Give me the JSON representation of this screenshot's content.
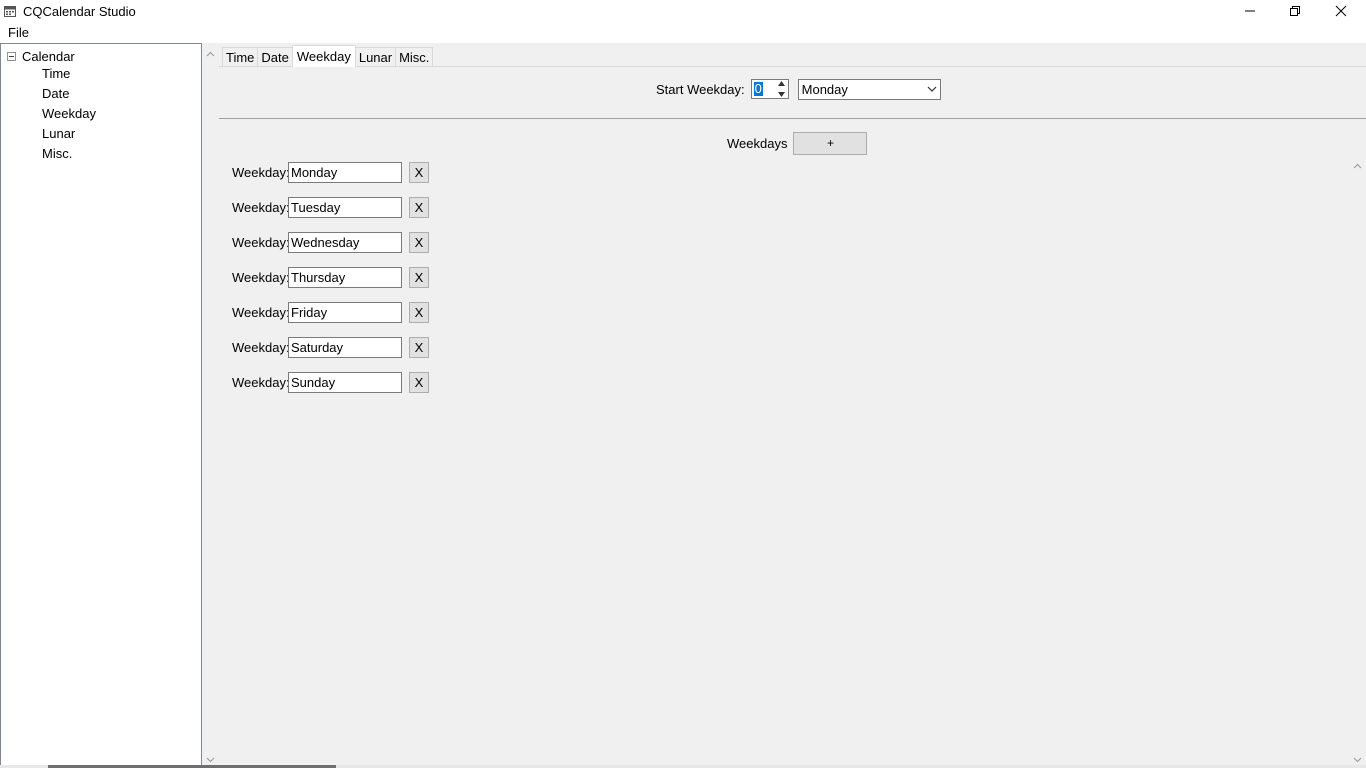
{
  "window": {
    "title": "CQCalendar Studio",
    "minimize_glyph": "—",
    "maximize_glyph": "❐",
    "close_glyph": "✕"
  },
  "menu": {
    "items": [
      "File"
    ]
  },
  "tree": {
    "root": "Calendar",
    "children": [
      "Time",
      "Date",
      "Weekday",
      "Lunar",
      "Misc."
    ]
  },
  "tabs": [
    {
      "label": "Time",
      "active": false
    },
    {
      "label": "Date",
      "active": false
    },
    {
      "label": "Weekday",
      "active": true
    },
    {
      "label": "Lunar",
      "active": false
    },
    {
      "label": "Misc.",
      "active": false
    }
  ],
  "weekday_panel": {
    "start_label": "Start Weekday:",
    "start_value": "0",
    "start_combo_value": "Monday",
    "weekdays_label": "Weekdays",
    "add_label": "+",
    "row_label": "Weekday:",
    "remove_label": "X",
    "weekdays": [
      "Monday",
      "Tuesday",
      "Wednesday",
      "Thursday",
      "Friday",
      "Saturday",
      "Sunday"
    ]
  },
  "icons": {
    "app": "app-icon",
    "tree_expander": "minus-box-icon",
    "scroll_up": "chevron-up-icon",
    "scroll_down": "chevron-down-icon",
    "combo_arrow": "chevron-down-icon"
  },
  "colors": {
    "selection": "#0078d7",
    "panel_bg": "#f0f0f0",
    "border": "#7a7a7a"
  }
}
